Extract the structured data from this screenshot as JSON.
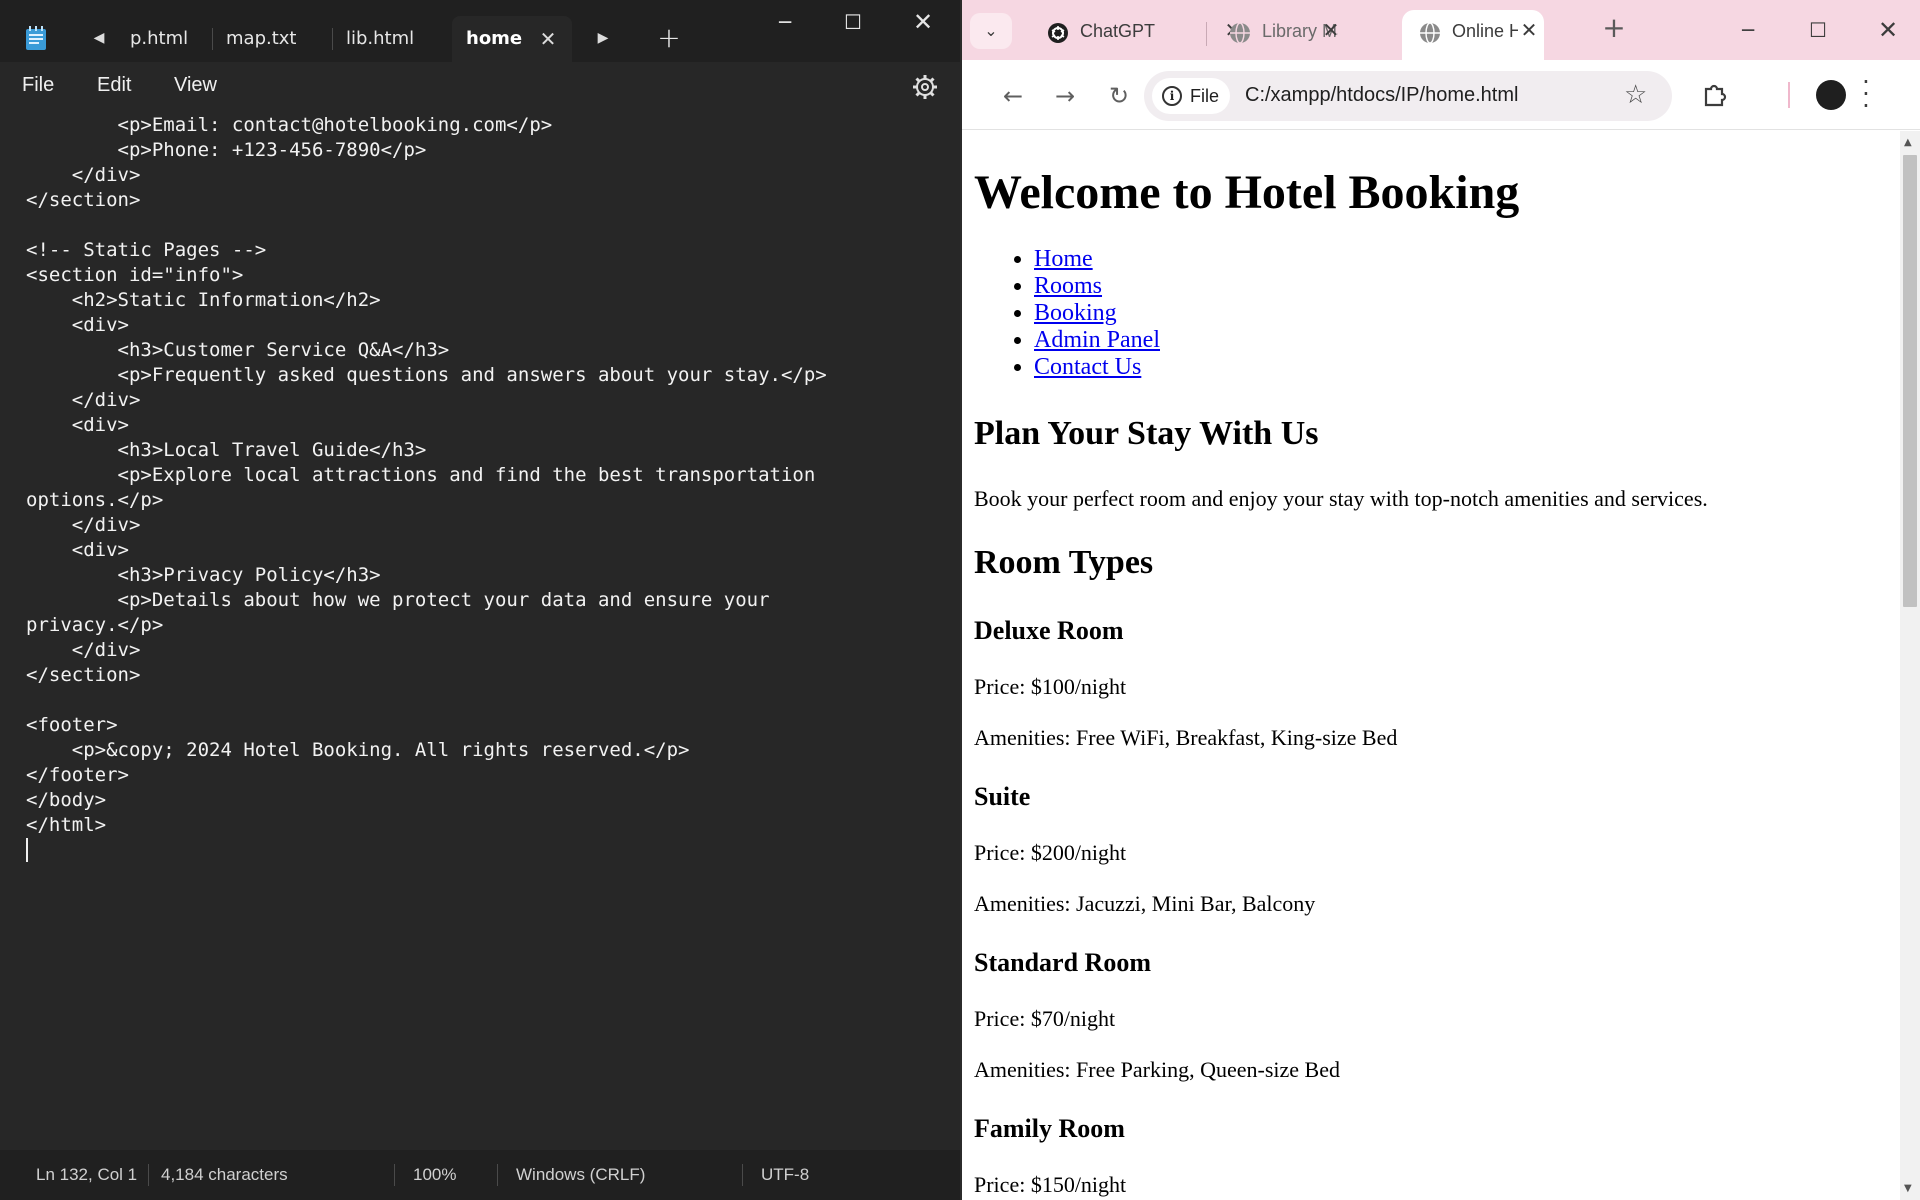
{
  "notepad": {
    "tabs": [
      {
        "label": "p.html"
      },
      {
        "label": "map.txt"
      },
      {
        "label": "lib.html"
      },
      {
        "label": "home",
        "active": true
      }
    ],
    "menu": [
      "File",
      "Edit",
      "View"
    ],
    "code": "        <p>Email: contact@hotelbooking.com</p>\n        <p>Phone: +123-456-7890</p>\n    </div>\n</section>\n\n<!-- Static Pages -->\n<section id=\"info\">\n    <h2>Static Information</h2>\n    <div>\n        <h3>Customer Service Q&A</h3>\n        <p>Frequently asked questions and answers about your stay.</p>\n    </div>\n    <div>\n        <h3>Local Travel Guide</h3>\n        <p>Explore local attractions and find the best transportation\noptions.</p>\n    </div>\n    <div>\n        <h3>Privacy Policy</h3>\n        <p>Details about how we protect your data and ensure your\nprivacy.</p>\n    </div>\n</section>\n\n<footer>\n    <p>&copy; 2024 Hotel Booking. All rights reserved.</p>\n</footer>\n</body>\n</html>",
    "status": {
      "position": "Ln 132, Col 1",
      "characters": "4,184 characters",
      "zoom": "100%",
      "line_ending": "Windows (CRLF)",
      "encoding": "UTF-8"
    }
  },
  "browser": {
    "tabs": [
      {
        "label": "ChatGPT",
        "icon": "chatgpt-icon"
      },
      {
        "label": "Library Ma",
        "icon": "globe-icon"
      },
      {
        "label": "Online Ho",
        "icon": "globe-icon",
        "active": true
      }
    ],
    "site_chip": "File",
    "url": "C:/xampp/htdocs/IP/home.html",
    "page": {
      "title": "Welcome to Hotel Booking",
      "nav": [
        "Home",
        "Rooms",
        "Booking",
        "Admin Panel",
        "Contact Us"
      ],
      "plan_heading": "Plan Your Stay With Us",
      "plan_text": "Book your perfect room and enjoy your stay with top-notch amenities and services.",
      "rooms_heading": "Room Types",
      "rooms": [
        {
          "name": "Deluxe Room",
          "price": "Price: $100/night",
          "amenities": "Amenities: Free WiFi, Breakfast, King-size Bed"
        },
        {
          "name": "Suite",
          "price": "Price: $200/night",
          "amenities": "Amenities: Jacuzzi, Mini Bar, Balcony"
        },
        {
          "name": "Standard Room",
          "price": "Price: $70/night",
          "amenities": "Amenities: Free Parking, Queen-size Bed"
        },
        {
          "name": "Family Room",
          "price": "Price: $150/night"
        }
      ]
    }
  },
  "colors": {
    "notepad_bg": "#272727",
    "chrome_tabstrip": "#f6d7e2",
    "link": "#0000ee"
  }
}
